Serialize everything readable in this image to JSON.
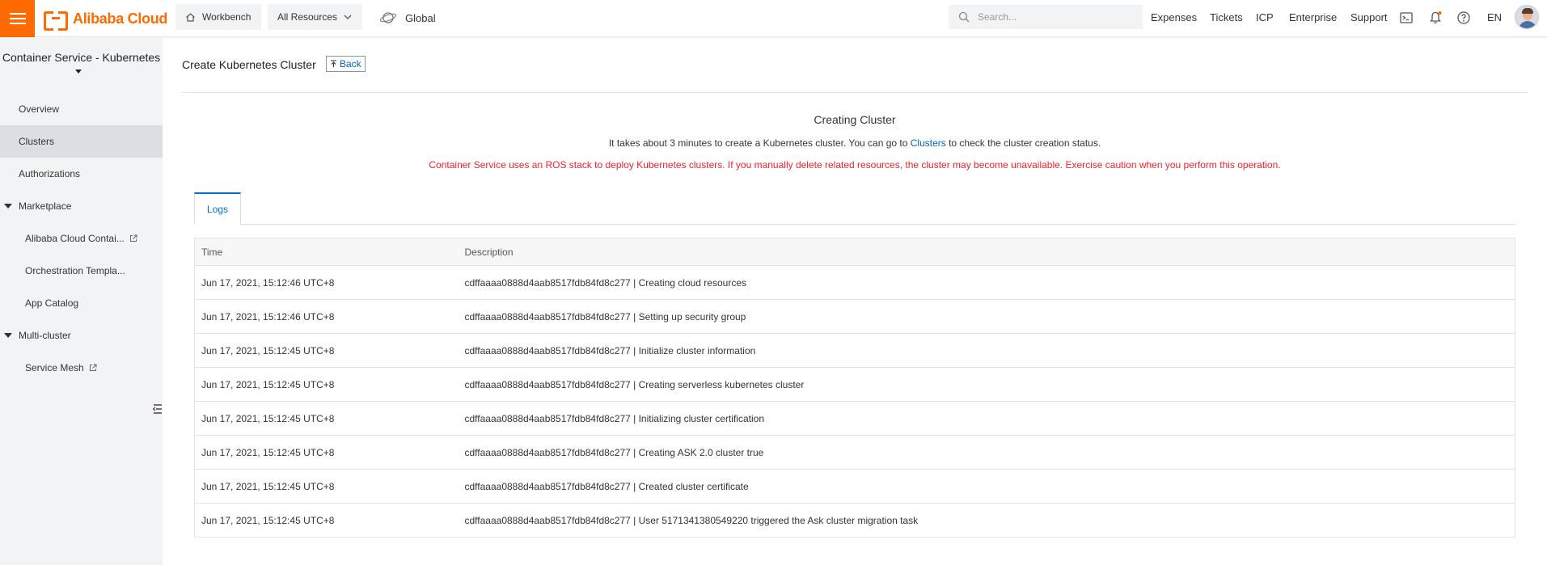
{
  "header": {
    "brand": "Alibaba Cloud",
    "workbench_label": "Workbench",
    "all_resources_label": "All Resources",
    "region_label": "Global",
    "search_placeholder": "Search...",
    "links": [
      "Expenses",
      "Tickets",
      "ICP",
      "Enterprise",
      "Support"
    ],
    "language": "EN",
    "accent_color": "#ff6a00"
  },
  "sidebar": {
    "title": "Container Service - Kubernetes",
    "items": [
      {
        "label": "Overview"
      },
      {
        "label": "Clusters",
        "active": true
      },
      {
        "label": "Authorizations"
      },
      {
        "label": "Marketplace",
        "group": true
      },
      {
        "label": "Alibaba Cloud Contai...",
        "external": true
      },
      {
        "label": "Orchestration Templa..."
      },
      {
        "label": "App Catalog"
      },
      {
        "label": "Multi-cluster",
        "group": true
      },
      {
        "label": "Service Mesh",
        "external": true
      }
    ]
  },
  "main": {
    "page_title": "Create Kubernetes Cluster",
    "back_label": "Back",
    "status_title": "Creating Cluster",
    "status_desc_before": "It takes about 3 minutes to create a Kubernetes cluster. You can go to ",
    "status_desc_link": "Clusters",
    "status_desc_after": " to check the cluster creation status.",
    "warning": "Container Service uses an ROS stack to deploy Kubernetes clusters. If you manually delete related resources, the cluster may become unavailable. Exercise caution when you perform this operation.",
    "warning_color": "#f5222d",
    "link_color": "#0064c8",
    "tabs": [
      {
        "label": "Logs",
        "active": true
      }
    ],
    "log_table": {
      "columns": [
        "Time",
        "Description"
      ],
      "rows": [
        {
          "time": "Jun 17, 2021, 15:12:46 UTC+8",
          "desc": "cdffaaaa0888d4aab8517fdb84fd8c277 | Creating cloud resources"
        },
        {
          "time": "Jun 17, 2021, 15:12:46 UTC+8",
          "desc": "cdffaaaa0888d4aab8517fdb84fd8c277 | Setting up security group"
        },
        {
          "time": "Jun 17, 2021, 15:12:45 UTC+8",
          "desc": "cdffaaaa0888d4aab8517fdb84fd8c277 | Initialize cluster information"
        },
        {
          "time": "Jun 17, 2021, 15:12:45 UTC+8",
          "desc": "cdffaaaa0888d4aab8517fdb84fd8c277 | Creating serverless kubernetes cluster"
        },
        {
          "time": "Jun 17, 2021, 15:12:45 UTC+8",
          "desc": "cdffaaaa0888d4aab8517fdb84fd8c277 | Initializing cluster certification"
        },
        {
          "time": "Jun 17, 2021, 15:12:45 UTC+8",
          "desc": "cdffaaaa0888d4aab8517fdb84fd8c277 | Creating ASK 2.0 cluster true"
        },
        {
          "time": "Jun 17, 2021, 15:12:45 UTC+8",
          "desc": "cdffaaaa0888d4aab8517fdb84fd8c277 | Created cluster certificate"
        },
        {
          "time": "Jun 17, 2021, 15:12:45 UTC+8",
          "desc": "cdffaaaa0888d4aab8517fdb84fd8c277 | User 5171341380549220 triggered the Ask cluster migration task"
        }
      ]
    }
  }
}
